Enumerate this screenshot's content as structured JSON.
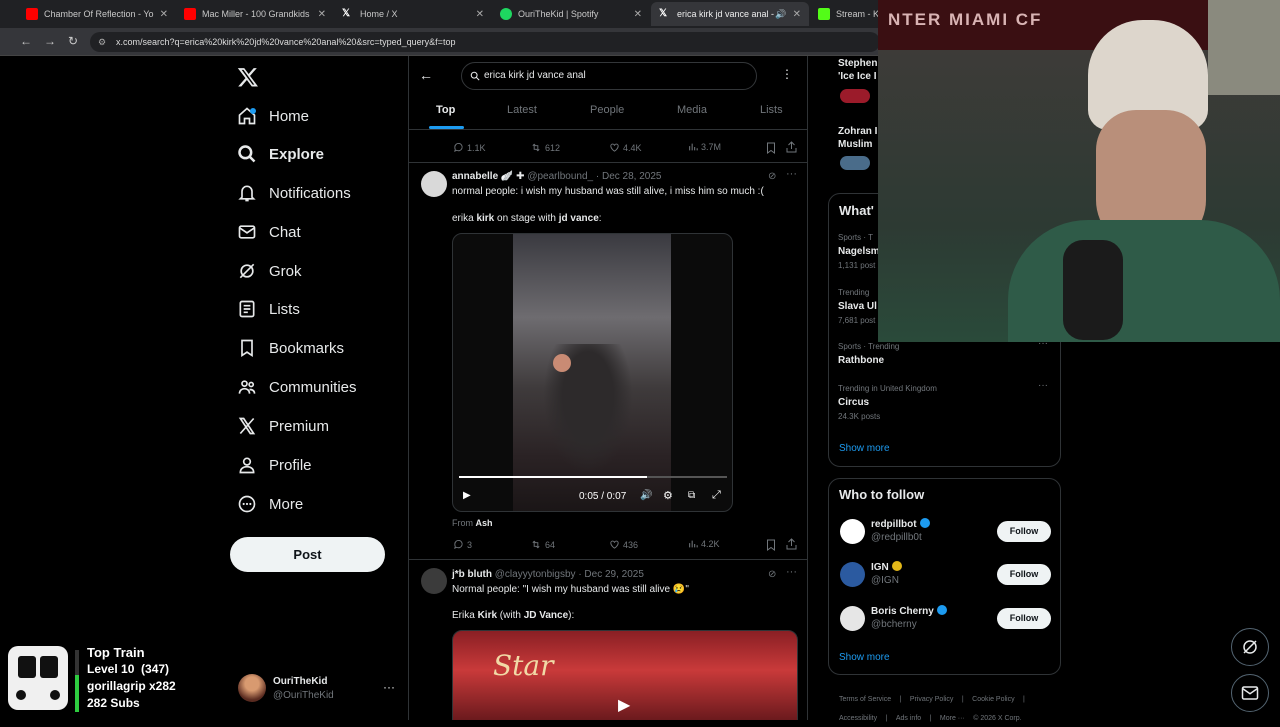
{
  "browser": {
    "tabs": [
      {
        "title": "Chamber Of Reflection - YouTube",
        "color": "#ff0000"
      },
      {
        "title": "Mac Miller - 100 Grandkids",
        "color": "#ff0000"
      },
      {
        "title": "Home / X",
        "color": "#ffffff"
      },
      {
        "title": "OuriTheKid | Spotify",
        "color": "#1ed760"
      },
      {
        "title": "erica kirk jd vance anal - Se",
        "color": "#ffffff"
      },
      {
        "title": "Stream - Ki",
        "color": "#53fc18"
      }
    ],
    "url": "x.com/search?q=erica%20kirk%20jd%20vance%20anal%20&src=typed_query&f=top"
  },
  "sidebar": {
    "items": [
      {
        "label": "Home",
        "icon": "home-icon"
      },
      {
        "label": "Explore",
        "icon": "search-icon"
      },
      {
        "label": "Notifications",
        "icon": "bell-icon"
      },
      {
        "label": "Chat",
        "icon": "mail-icon"
      },
      {
        "label": "Grok",
        "icon": "grok-icon"
      },
      {
        "label": "Lists",
        "icon": "list-icon"
      },
      {
        "label": "Bookmarks",
        "icon": "bookmark-icon"
      },
      {
        "label": "Communities",
        "icon": "people-icon"
      },
      {
        "label": "Premium",
        "icon": "x-icon"
      },
      {
        "label": "Profile",
        "icon": "person-icon"
      },
      {
        "label": "More",
        "icon": "more-icon"
      }
    ],
    "post_label": "Post",
    "account": {
      "name": "OuriTheKid",
      "handle": "@OuriTheKid"
    }
  },
  "search": {
    "query": "erica kirk jd vance anal",
    "tabs": [
      "Top",
      "Latest",
      "People",
      "Media",
      "Lists"
    ]
  },
  "tweet0": {
    "replies": "1.1K",
    "reposts": "612",
    "likes": "4.4K",
    "views": "3.7M"
  },
  "tweet1": {
    "name": "annabelle",
    "badges": "🪽 ✚",
    "handle": "@pearlbound_",
    "date": "· Dec 28, 2025",
    "line1": "normal people: i wish my husband was still alive, i miss him so much :(",
    "line2_pre": "erika ",
    "line2_b1": "kirk",
    "line2_mid": " on stage with ",
    "line2_b2": "jd vance",
    "line2_post": ":",
    "video_time": "0:05 / 0:07",
    "progress": 0.7,
    "from_label": "From",
    "from_name": "Ash",
    "replies": "3",
    "reposts": "64",
    "likes": "436",
    "views": "4.2K"
  },
  "tweet2": {
    "name": "j*b bluth",
    "handle": "@clayyytonbigsby",
    "date": "· Dec 29, 2025",
    "line1": "Normal people: \"I wish my husband was still alive 😢\"",
    "line2_pre": "Erika ",
    "line2_b1": "Kirk",
    "line2_mid": " (with ",
    "line2_b2": "JD Vance",
    "line2_post": "):",
    "video_text": "Star"
  },
  "right": {
    "top_trends": [
      {
        "name": "Stephen",
        "sub": "'Ice Ice I"
      },
      {
        "name": "Zohran I",
        "sub": "Muslim"
      }
    ],
    "whats_happening": "What'",
    "trends": [
      {
        "cat": "Sports · T",
        "name": "Nagelsm",
        "posts": "1,131 post"
      },
      {
        "cat": "Trending",
        "name": "Slava Ul",
        "posts": "7,681 post"
      },
      {
        "cat": "Sports · Trending",
        "name": "Rathbone",
        "posts": ""
      },
      {
        "cat": "Trending in United Kingdom",
        "name": "Circus",
        "posts": "24.3K posts"
      }
    ],
    "show_more": "Show more",
    "who_to_follow": "Who to follow",
    "suggestions": [
      {
        "name": "redpillbot",
        "handle": "@redpillb0t",
        "badge_color": "#1d9bf0"
      },
      {
        "name": "IGN",
        "handle": "@IGN",
        "badge_color": "#e2b719"
      },
      {
        "name": "Boris Cherny",
        "handle": "@bcherny",
        "badge_color": "#1d9bf0"
      }
    ],
    "follow_label": "Follow",
    "footer": [
      "Terms of Service",
      "|",
      "Privacy Policy",
      "|",
      "Cookie Policy",
      "|",
      "Accessibility",
      "|",
      "Ads info",
      "|",
      "More ···",
      "© 2026 X Corp."
    ]
  },
  "train": {
    "title": "Top Train",
    "level": "Level 10  (347)",
    "user": "gorillagrip x282",
    "subs": "282 Subs",
    "progress": 0.6
  },
  "webcam_text": "NTER MIAMI CF"
}
